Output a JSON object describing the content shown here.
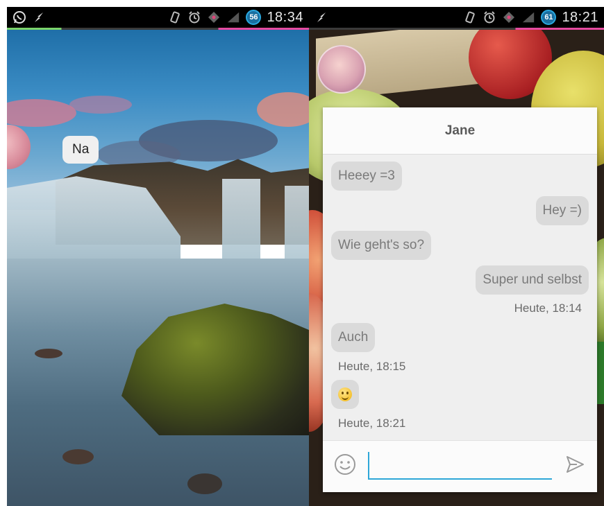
{
  "left_screen": {
    "status": {
      "time": "18:34",
      "battery_level": "56"
    },
    "chathead_bubble": "Na"
  },
  "right_screen": {
    "status": {
      "time": "18:21",
      "battery_level": "61"
    },
    "chat": {
      "title": "Jane",
      "messages": [
        {
          "text": "Heeey =3",
          "side": "in"
        },
        {
          "text": "Hey =)",
          "side": "out"
        },
        {
          "text": "Wie geht's so?",
          "side": "in"
        },
        {
          "text": "Super und selbst",
          "side": "out"
        }
      ],
      "stamp_1": "Heute, 18:14",
      "message_auch": "Auch",
      "stamp_2": "Heute, 18:15",
      "emoji_message": "smiley-emoji",
      "stamp_3": "Heute, 18:21"
    },
    "input": {
      "value": "",
      "placeholder": ""
    }
  },
  "colors": {
    "accent_blue": "#2ea7d8",
    "bubble_grey": "#dadada",
    "panel_bg": "#efefef"
  },
  "icons": {
    "whatsapp": "whatsapp-icon",
    "charging": "charging-icon",
    "vibrate": "vibrate-icon",
    "alarm": "alarm-icon",
    "signal": "signal-icon",
    "emoji": "smiley-icon",
    "send": "send-icon"
  }
}
